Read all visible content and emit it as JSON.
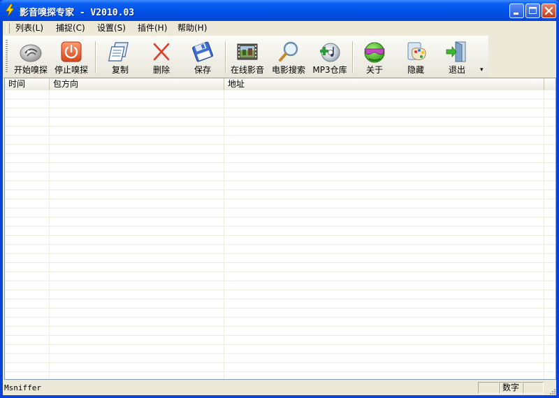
{
  "window": {
    "title": "影音嗅探专家 - V2010.03",
    "colors": {
      "titlebar": "#0350e6",
      "client": "#ece9d8",
      "close_button": "#c43d19"
    }
  },
  "menu": {
    "items": [
      {
        "label": "列表(L)"
      },
      {
        "label": "捕捉(C)"
      },
      {
        "label": "设置(S)"
      },
      {
        "label": "插件(H)"
      },
      {
        "label": "帮助(H)"
      }
    ]
  },
  "toolbar": {
    "buttons": [
      {
        "label": "开始嗅探",
        "icon": "start-sniff-icon"
      },
      {
        "label": "停止嗅探",
        "icon": "power-stop-icon"
      },
      {
        "label": "复制",
        "icon": "copy-icon"
      },
      {
        "label": "删除",
        "icon": "delete-x-icon"
      },
      {
        "label": "保存",
        "icon": "floppy-save-icon"
      },
      {
        "label": "在线影音",
        "icon": "film-icon"
      },
      {
        "label": "电影搜索",
        "icon": "magnifier-icon"
      },
      {
        "label": "MP3仓库",
        "icon": "cd-music-icon"
      },
      {
        "label": "关于",
        "icon": "globe-glasses-icon"
      },
      {
        "label": "隐藏",
        "icon": "palette-icon"
      },
      {
        "label": "退出",
        "icon": "exit-door-icon"
      }
    ]
  },
  "list": {
    "columns": [
      {
        "label": "时间"
      },
      {
        "label": "包方向"
      },
      {
        "label": "地址"
      }
    ],
    "rows": []
  },
  "status": {
    "text": "Msniffer",
    "panels": [
      "",
      "数字",
      ""
    ]
  }
}
